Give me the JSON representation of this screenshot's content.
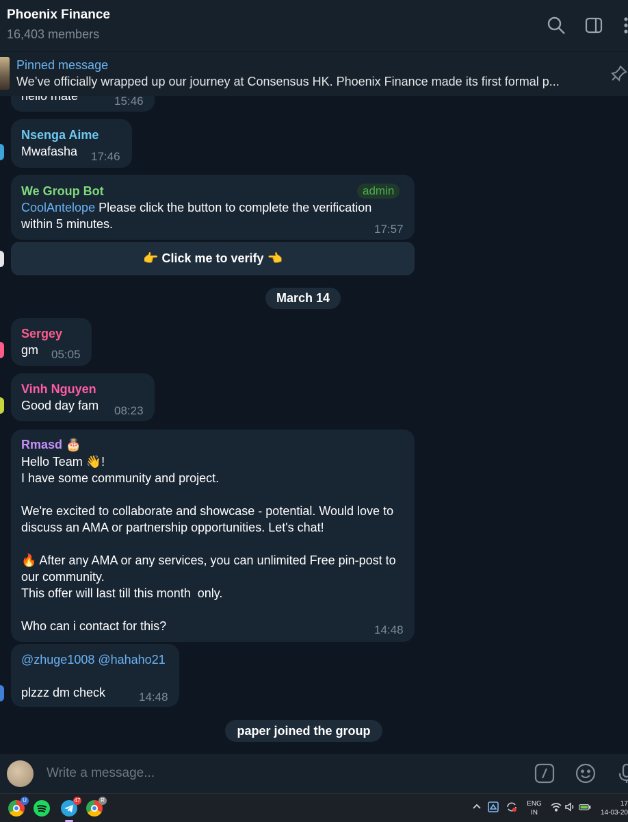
{
  "header": {
    "title": "Phoenix Finance",
    "members": "16,403 members"
  },
  "pinned": {
    "title": "Pinned message",
    "text": "We’ve officially wrapped up our journey at Consensus HK.  Phoenix Finance made its first formal p..."
  },
  "messages": [
    {
      "text": "hello mate",
      "time": "15:46"
    },
    {
      "sender": "Nsenga Aime",
      "sender_color": "#6ec9f0",
      "text": "Mwafasha",
      "time": "17:46"
    },
    {
      "sender": "We Group Bot",
      "sender_color": "#7fd97b",
      "role": "admin",
      "mention": "CoolAntelope",
      "text": " Please click the button to complete the verification within 5 minutes.",
      "time": "17:57",
      "button": "👉 Click me to verify 👈"
    },
    {
      "sender": "Sergey",
      "sender_color": "#ff5c8a",
      "text": "gm",
      "time": "05:05"
    },
    {
      "sender": "Vinh Nguyen",
      "sender_color": "#ff5ca8",
      "text": "Good day fam",
      "time": "08:23"
    },
    {
      "sender": "Rmasd",
      "sender_color": "#c490f5",
      "sender_emoji": "🎂",
      "text": "Hello Team 👋!\nI have some community and project.\n\nWe're excited to collaborate and showcase - potential. Would love to discuss an AMA or partnership opportunities. Let's chat!\n\n🔥 After any AMA or any services, you can unlimited Free pin-post to our community.\nThis offer will last till this month  only.\n\nWho can i contact for this?",
      "time": "14:48"
    },
    {
      "mention": "@zhuge1008 @hahaho21",
      "text": "plzzz dm check",
      "time": "14:48"
    }
  ],
  "service": {
    "date": "March 14",
    "joined": "paper joined the group"
  },
  "composer": {
    "placeholder": "Write a message..."
  },
  "taskbar": {
    "telegram_badge": "47",
    "chrome_badge_1": "U",
    "chrome_badge_2": "R",
    "lang_1": "ENG",
    "lang_2": "IN",
    "time": "17",
    "date": "14-03-20"
  },
  "colors": {
    "background": "#0e1621",
    "header": "#17212b",
    "bubble": "#182533",
    "link": "#6ab3f3",
    "admin": "#4fae4e"
  }
}
